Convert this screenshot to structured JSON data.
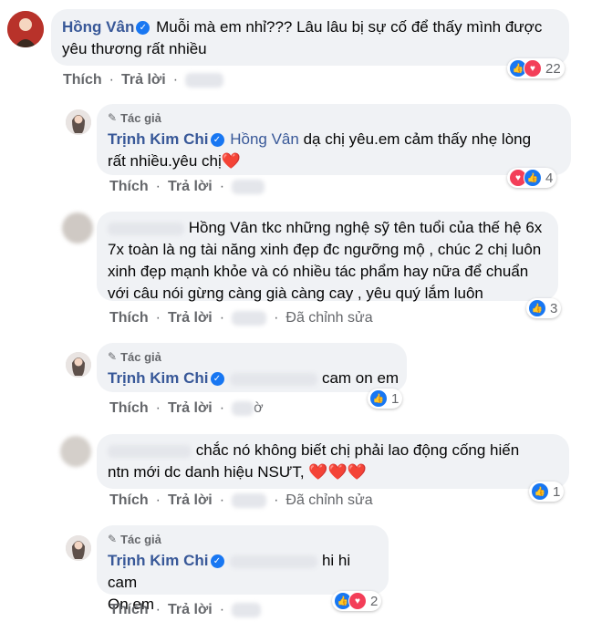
{
  "labels": {
    "like": "Thích",
    "reply": "Trả lời",
    "dot": "·",
    "author_badge": "Tác giả",
    "edited": "Đã chỉnh sửa"
  },
  "colors": {
    "link": "#385898",
    "bubble": "#f0f2f5",
    "meta": "#65676b",
    "like_reaction": "#1877f2",
    "love_reaction": "#f33e58"
  },
  "comments": [
    {
      "author": "Hồng Vân",
      "verified": true,
      "text": "Muỗi mà em nhỉ??? Lâu lâu bị sự cố để thấy mình được yêu thương rất nhiều",
      "reactions": [
        "like-icon",
        "love-icon"
      ],
      "reaction_count": "22"
    },
    {
      "author": "Trịnh Kim Chi",
      "verified": true,
      "author_badge": true,
      "tag": "Hồng Vân",
      "text_line1": "dạ chị yêu.em cảm thấy nhẹ lòng",
      "text_line2": "rất nhiều.yêu chị",
      "heart": "❤️",
      "reactions": [
        "love-icon",
        "like-icon"
      ],
      "reaction_count": "4"
    },
    {
      "tag": "Hồng Vân",
      "text": "tkc những nghệ sỹ tên tuổi của thế hệ 6x 7x toàn là ng tài năng xinh đẹp đc ngưỡng mộ , chúc 2 chị luôn xinh đẹp mạnh khỏe và có nhiều tác phẩm hay nữa để chuẩn với câu nói gừng càng già càng cay , yêu quý lắm luôn",
      "reactions": [
        "like-icon"
      ],
      "reaction_count": "3",
      "edited": true
    },
    {
      "author": "Trịnh Kim Chi",
      "verified": true,
      "author_badge": true,
      "text": "cam on em",
      "reactions": [
        "like-icon"
      ],
      "reaction_count": "1",
      "time_fragment": "ờ"
    },
    {
      "text_line1": "chắc nó không biết chị phải lao động cống hiến",
      "text_line2": "ntn mới dc danh hiệu NSƯT,",
      "hearts": "❤️❤️❤️",
      "reactions": [
        "like-icon"
      ],
      "reaction_count": "1",
      "edited": true
    },
    {
      "author": "Trịnh Kim Chi",
      "verified": true,
      "author_badge": true,
      "text_line1": "hi hi cam",
      "text_line2": "On em",
      "reactions": [
        "like-icon",
        "love-icon"
      ],
      "reaction_count": "2"
    }
  ]
}
